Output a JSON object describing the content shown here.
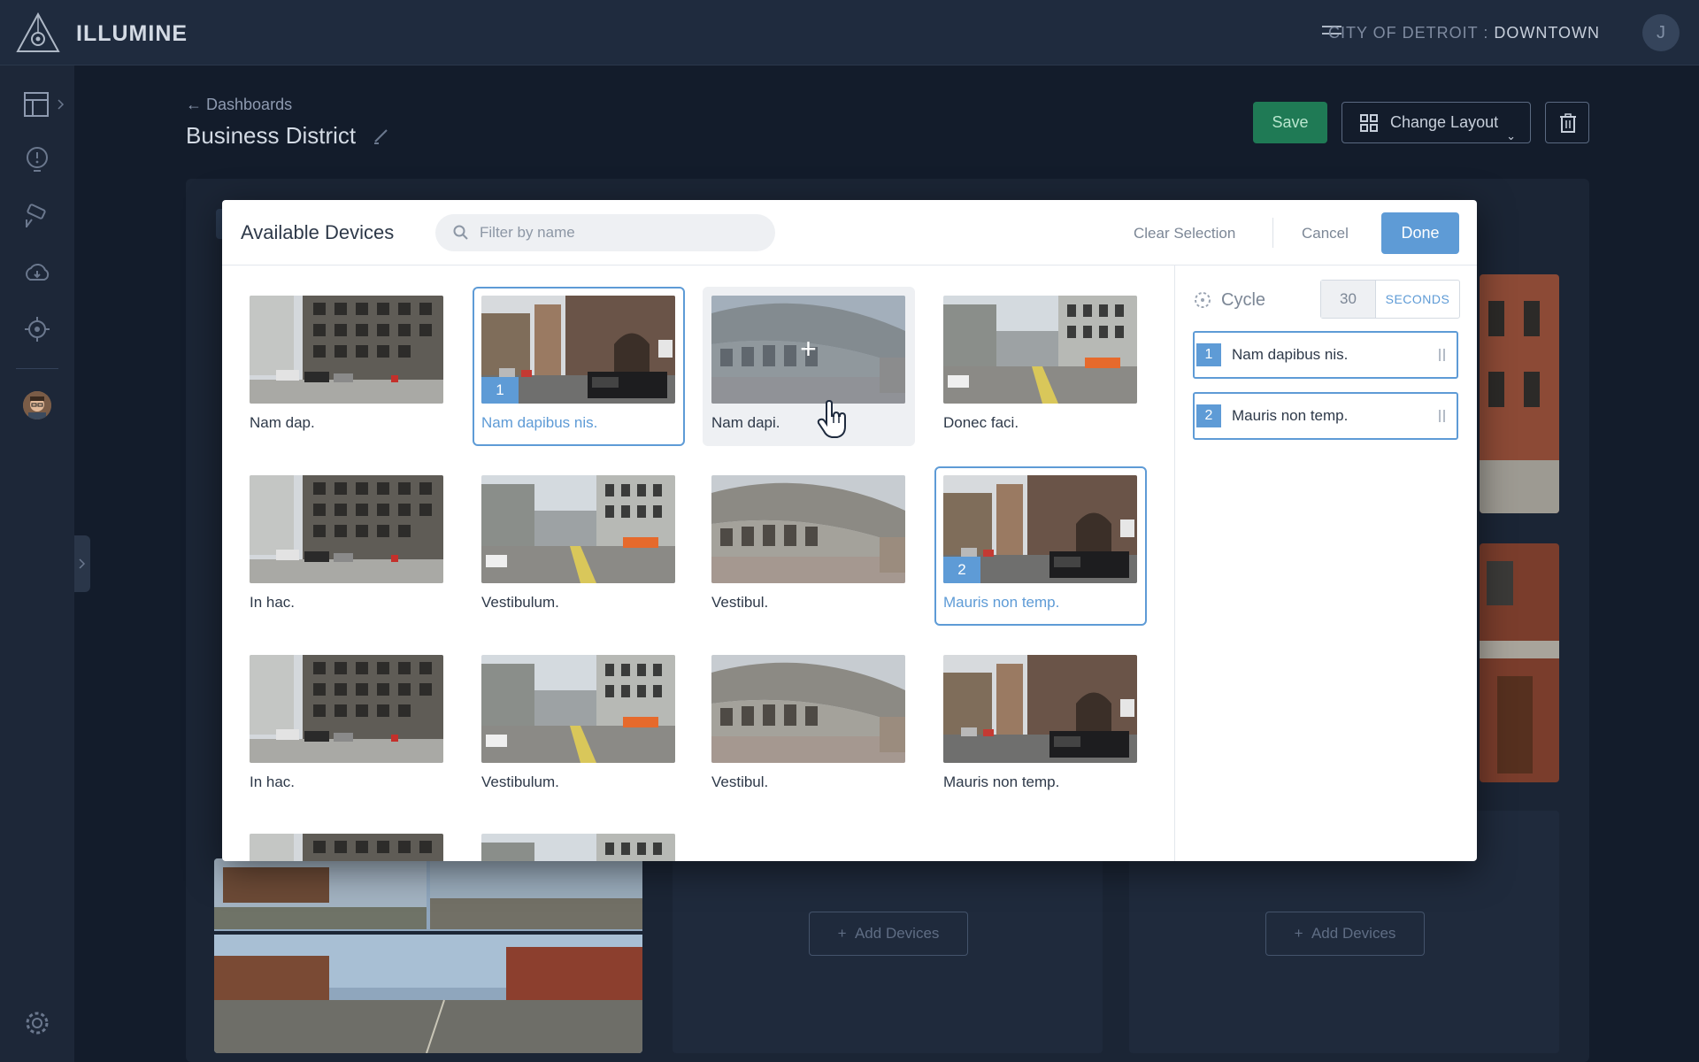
{
  "header": {
    "brand": "ILLUMINE",
    "location_prefix": "CITY OF DETROIT :",
    "location_name": "DOWNTOWN",
    "user_initial": "J"
  },
  "page": {
    "back_label": "Dashboards",
    "title": "Business District",
    "save_label": "Save",
    "layout_label": "Change Layout",
    "add_devices_label": "Add Devices"
  },
  "modal": {
    "title": "Available Devices",
    "filter_placeholder": "Filter by name",
    "clear_label": "Clear Selection",
    "cancel_label": "Cancel",
    "done_label": "Done",
    "devices": [
      {
        "label": "Nam dap.",
        "scene": "bldg"
      },
      {
        "label": "Nam dapibus nis.",
        "scene": "church",
        "order": "1"
      },
      {
        "label": "Nam dapi.",
        "scene": "curve"
      },
      {
        "label": "Donec faci.",
        "scene": "street"
      },
      {
        "label": "In hac.",
        "scene": "bldg"
      },
      {
        "label": "Vestibulum.",
        "scene": "street"
      },
      {
        "label": "Vestibul.",
        "scene": "curve"
      },
      {
        "label": "Mauris non temp.",
        "scene": "church",
        "order": "2"
      },
      {
        "label": "In hac.",
        "scene": "bldg"
      },
      {
        "label": "Vestibulum.",
        "scene": "street"
      },
      {
        "label": "Vestibul.",
        "scene": "curve"
      },
      {
        "label": "Mauris non temp.",
        "scene": "church"
      },
      {
        "label": "",
        "scene": "bldg"
      },
      {
        "label": "",
        "scene": "street"
      }
    ],
    "cycle": {
      "label": "Cycle",
      "value": "30",
      "unit": "SECONDS"
    },
    "selected": [
      {
        "num": "1",
        "label": "Nam dapibus nis."
      },
      {
        "num": "2",
        "label": "Mauris non temp."
      }
    ]
  }
}
